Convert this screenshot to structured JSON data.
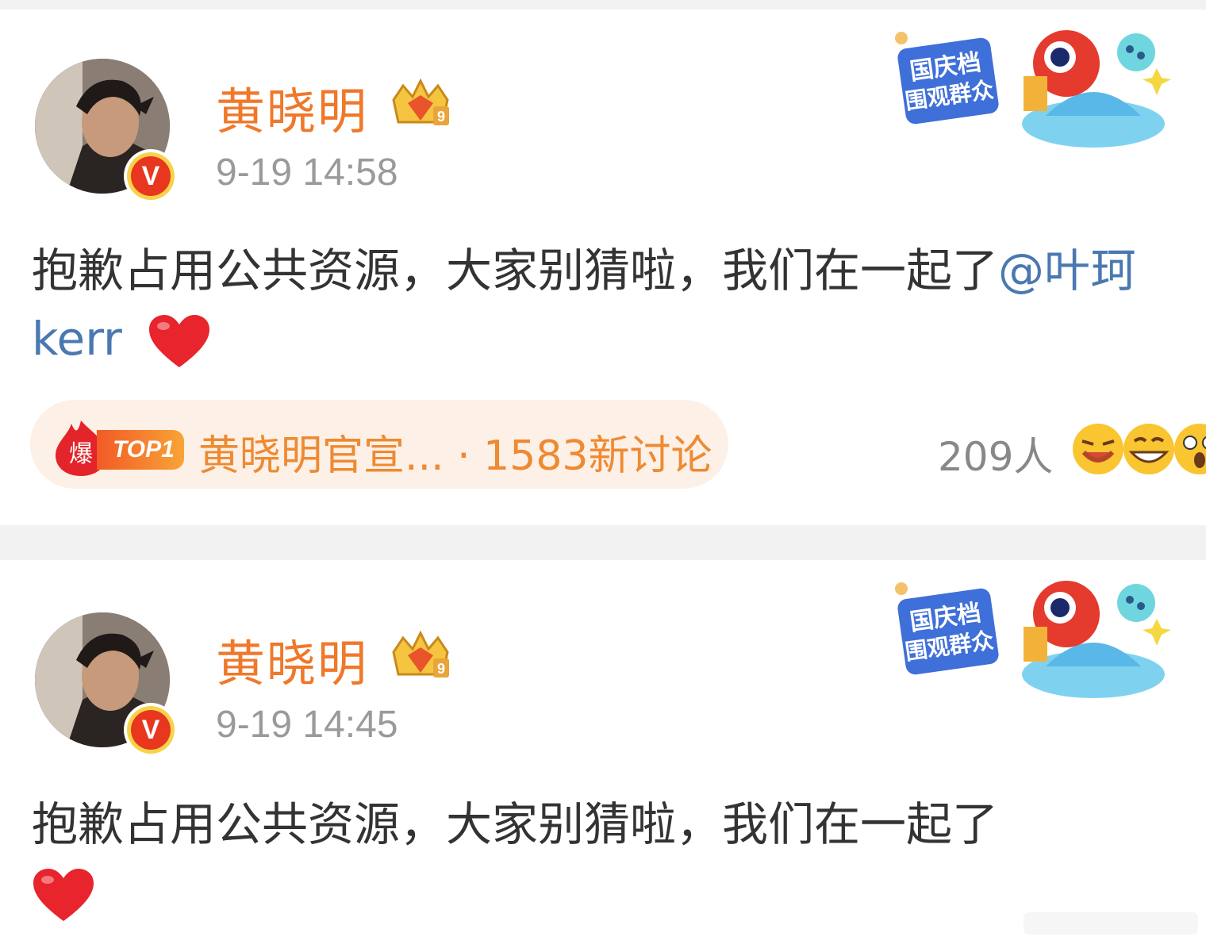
{
  "posts": [
    {
      "author": "黄晓明",
      "time": "9-19 14:58",
      "text": "抱歉占用公共资源，大家别猜啦，我们在一起了",
      "mention": "@叶珂kerr",
      "verified_badge": "V",
      "crown_level": "9",
      "event_badge": "国庆档 围观群众",
      "hot_topic": {
        "label": "爆",
        "rank": "TOP1",
        "text": "黄晓明官宣... · 1583新讨论"
      },
      "reaction_count": "209人"
    },
    {
      "author": "黄晓明",
      "time": "9-19 14:45",
      "text": "抱歉占用公共资源，大家别猜啦，我们在一起了",
      "verified_badge": "V",
      "crown_level": "9",
      "event_badge": "国庆档 围观群众"
    }
  ],
  "colors": {
    "author": "#f0782a",
    "mention": "#4a78b0",
    "hot": "#ee8a32",
    "heart": "#e8242c"
  }
}
